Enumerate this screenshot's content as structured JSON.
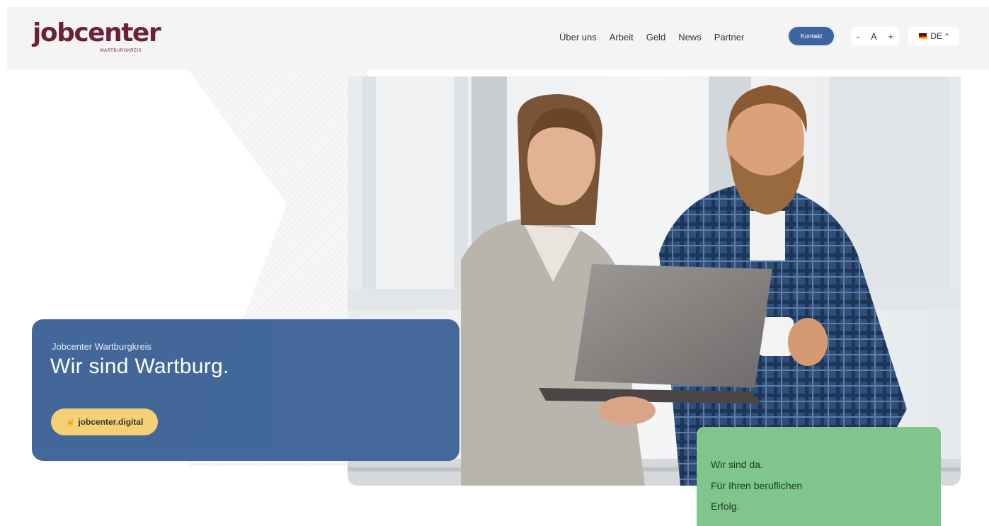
{
  "header": {
    "logo_text": "jobcenter",
    "logo_subtext": "WARTBURGKREIS",
    "nav": [
      "Über uns",
      "Arbeit",
      "Geld",
      "News",
      "Partner"
    ],
    "contact_label": "Kontakt",
    "font_controls": {
      "decrease": "-",
      "label": "A",
      "increase": "+"
    },
    "language": "DE"
  },
  "hero": {
    "subtitle": "Jobcenter Wartburgkreis",
    "title": "Wir sind Wartburg.",
    "cta_label": "jobcenter.digital"
  },
  "green_card": {
    "lines": [
      "Wir sind da.",
      "Für Ihren beruflichen",
      "Erfolg."
    ]
  },
  "colors": {
    "brand": "#6b2333",
    "primary_blue": "#3d6396",
    "cta_yellow": "#f5cf70",
    "green": "#7fc58c"
  }
}
